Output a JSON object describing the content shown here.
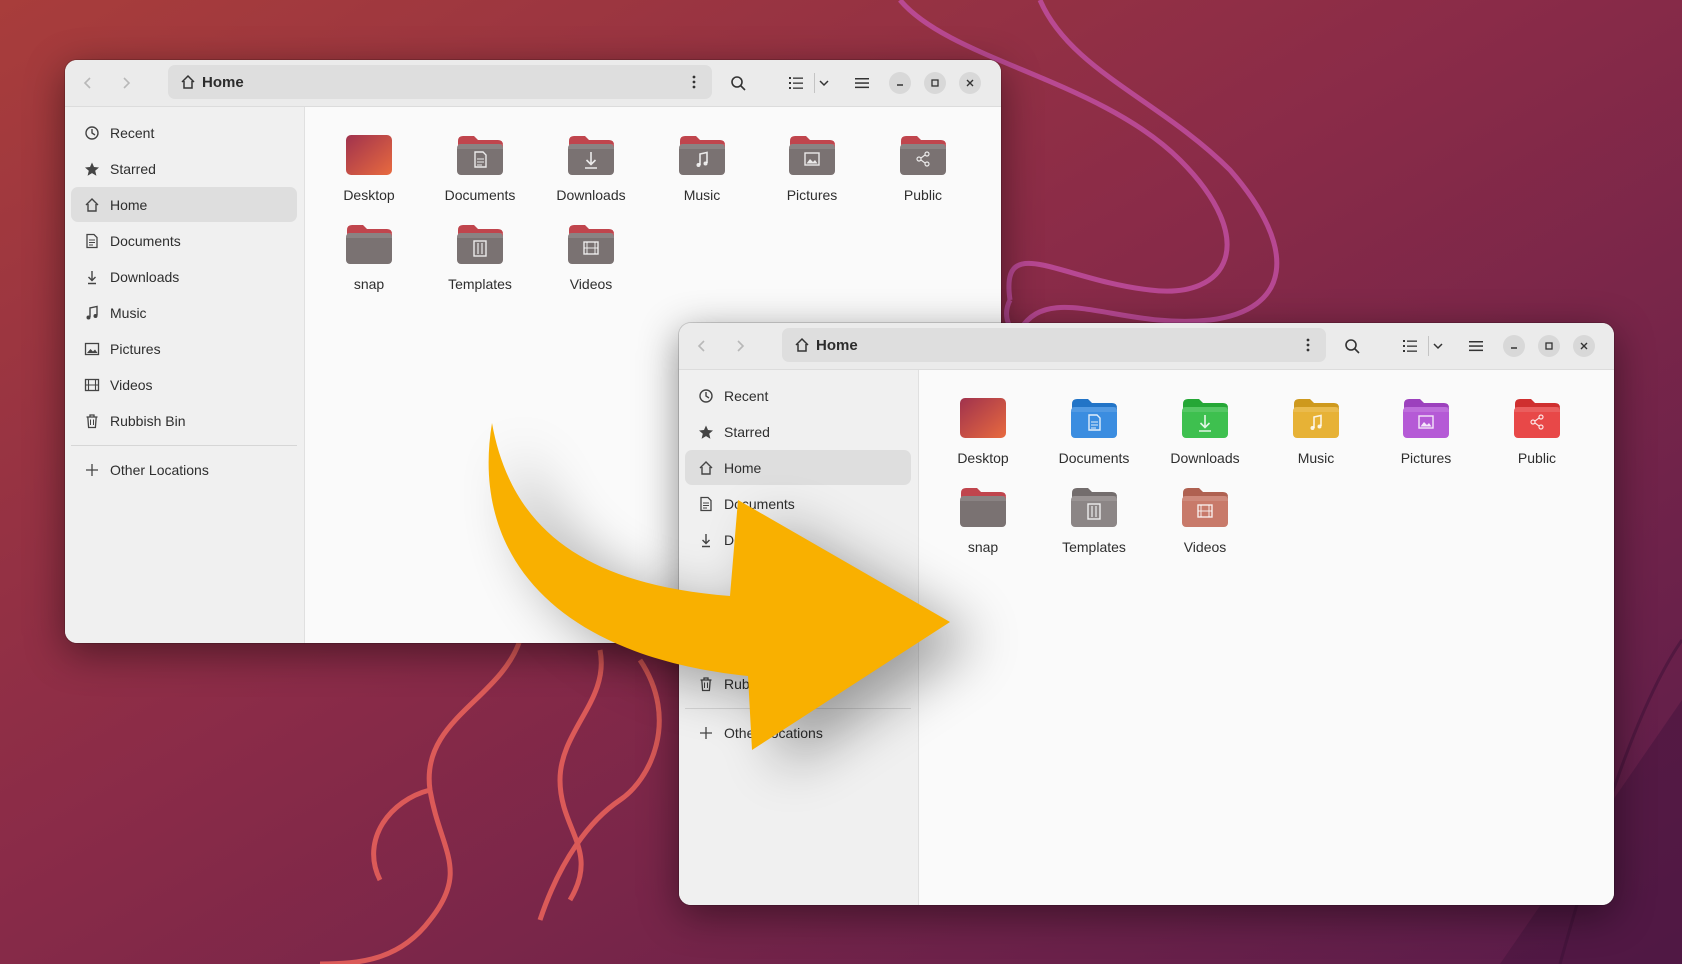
{
  "colors": {
    "accent_arrow": "#f9b000",
    "old_folder_body": "#7a7272",
    "old_folder_tab": "#c0454d",
    "desktop_gradient_start": "#a0324d",
    "desktop_gradient_end": "#e86a3f"
  },
  "old_window": {
    "path_label": "Home",
    "sidebar": [
      {
        "label": "Recent",
        "icon": "clock-icon"
      },
      {
        "label": "Starred",
        "icon": "star-icon"
      },
      {
        "label": "Home",
        "icon": "home-icon",
        "active": true
      },
      {
        "label": "Documents",
        "icon": "document-icon"
      },
      {
        "label": "Downloads",
        "icon": "download-icon"
      },
      {
        "label": "Music",
        "icon": "music-icon"
      },
      {
        "label": "Pictures",
        "icon": "picture-icon"
      },
      {
        "label": "Videos",
        "icon": "video-icon"
      },
      {
        "label": "Rubbish Bin",
        "icon": "trash-icon"
      }
    ],
    "other_locations": "Other Locations",
    "folders": [
      {
        "label": "Desktop",
        "icon": "desktop-folder-icon"
      },
      {
        "label": "Documents",
        "icon": "documents-folder-icon"
      },
      {
        "label": "Downloads",
        "icon": "downloads-folder-icon"
      },
      {
        "label": "Music",
        "icon": "music-folder-icon"
      },
      {
        "label": "Pictures",
        "icon": "pictures-folder-icon"
      },
      {
        "label": "Public",
        "icon": "public-folder-icon"
      },
      {
        "label": "snap",
        "icon": "folder-icon"
      },
      {
        "label": "Templates",
        "icon": "templates-folder-icon"
      },
      {
        "label": "Videos",
        "icon": "videos-folder-icon"
      }
    ]
  },
  "new_window": {
    "path_label": "Home",
    "sidebar": [
      {
        "label": "Recent",
        "icon": "clock-icon"
      },
      {
        "label": "Starred",
        "icon": "star-icon"
      },
      {
        "label": "Home",
        "icon": "home-icon",
        "active": true
      },
      {
        "label": "Documents",
        "icon": "document-icon"
      },
      {
        "label": "Do",
        "icon": "download-icon"
      },
      {
        "label": "Rub",
        "icon": "trash-icon"
      }
    ],
    "other_locations": "Other Locations",
    "folders": [
      {
        "label": "Desktop",
        "color": "#d0415a"
      },
      {
        "label": "Documents",
        "color": "#3b8de0"
      },
      {
        "label": "Downloads",
        "color": "#3ec04f"
      },
      {
        "label": "Music",
        "color": "#e7b236"
      },
      {
        "label": "Pictures",
        "color": "#b55ad6"
      },
      {
        "label": "Public",
        "color": "#e84848"
      },
      {
        "label": "snap",
        "color": "#7a7272"
      },
      {
        "label": "Templates",
        "color": "#8c8686"
      },
      {
        "label": "Videos",
        "color": "#c87a6a"
      }
    ]
  }
}
